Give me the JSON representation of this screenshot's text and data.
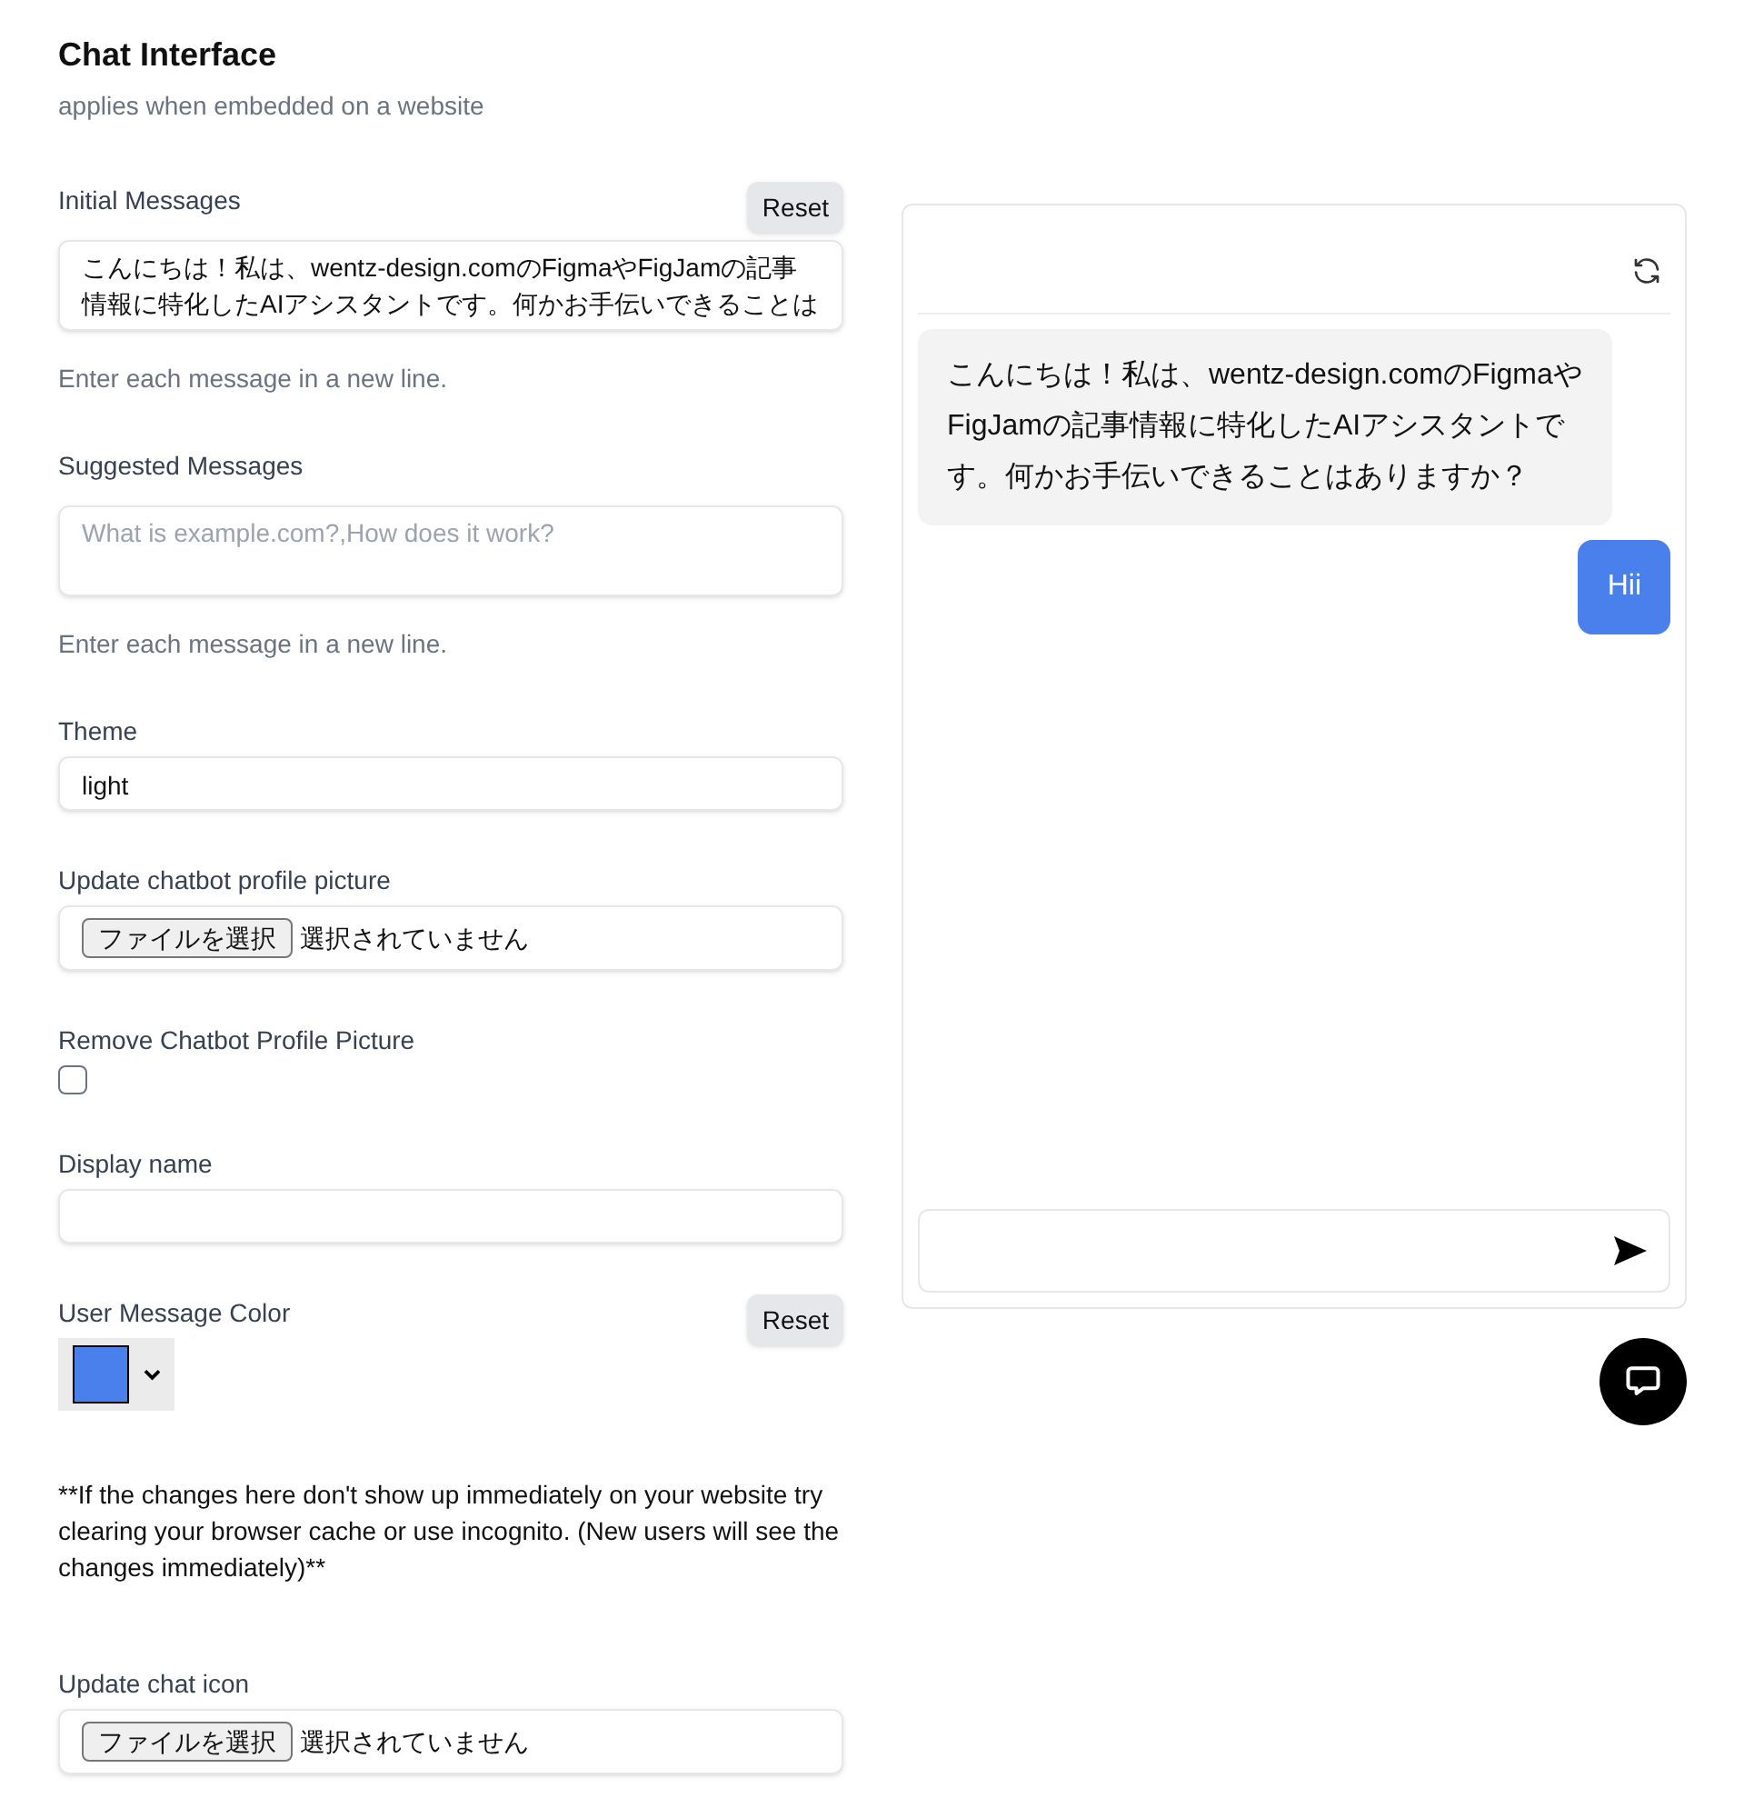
{
  "header": {
    "title": "Chat Interface",
    "subtitle": "applies when embedded on a website"
  },
  "fields": [
    {
      "kind": "textarea",
      "label": "Initial Messages",
      "reset": "Reset",
      "value": "こんにちは！私は、wentz-design.comのFigmaやFigJamの記事情報に特化したAIアシスタントです。何かお手伝いできることは",
      "help": "Enter each message in a new line."
    },
    {
      "kind": "textarea",
      "label": "Suggested Messages",
      "placeholder": "What is example.com?,How does it work?",
      "help": "Enter each message in a new line."
    },
    {
      "kind": "input",
      "label": "Theme",
      "value": "light"
    },
    {
      "kind": "file",
      "label": "Update chatbot profile picture",
      "button": "ファイルを選択",
      "status": "選択されていません"
    },
    {
      "kind": "checkbox",
      "label": "Remove Chatbot Profile Picture",
      "checked": false
    },
    {
      "kind": "input",
      "label": "Display name"
    },
    {
      "kind": "color",
      "label": "User Message Color",
      "reset": "Reset",
      "color": "#4a80ec"
    },
    {
      "kind": "note",
      "text": "**If the changes here don't show up immediately on your website try clearing your browser cache or use incognito. (New users will see the changes immediately)**"
    },
    {
      "kind": "file",
      "label": "Update chat icon",
      "button": "ファイルを選択",
      "status": "選択されていません"
    }
  ],
  "preview": {
    "messages": [
      {
        "kind": "bot",
        "text": "こんにちは！私は、wentz-design.comのFigmaやFigJamの記事情報に特化したAIアシスタントです。何かお手伝いできることはありますか？"
      },
      {
        "kind": "user",
        "text": "Hii"
      }
    ]
  }
}
